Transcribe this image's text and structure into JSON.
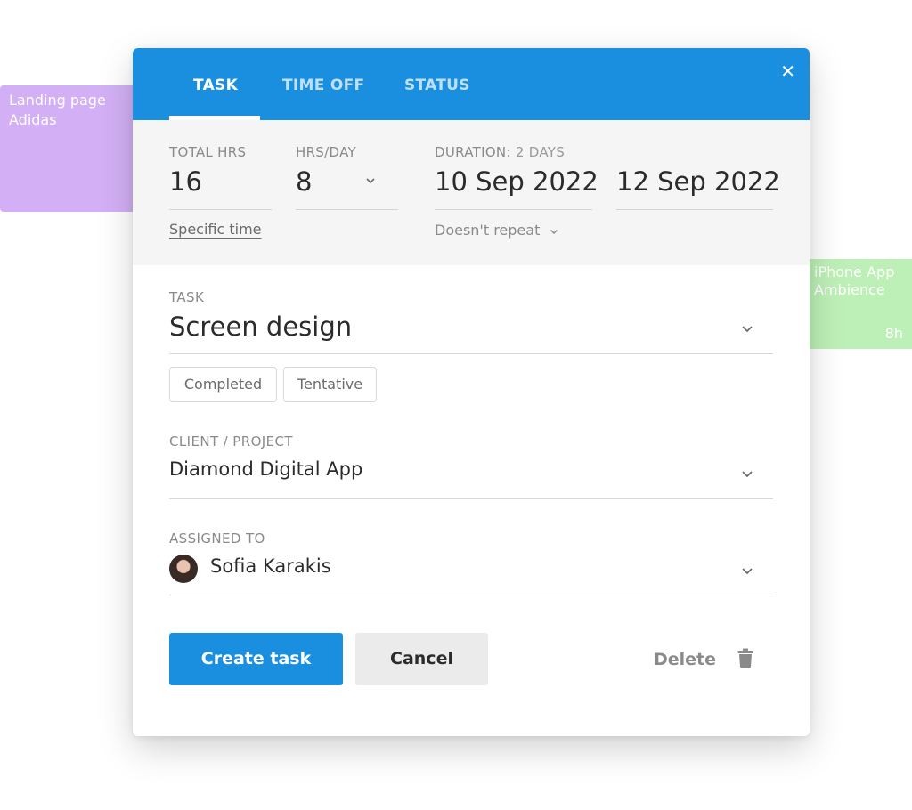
{
  "background_cards": {
    "left": {
      "title": "Landing page Adidas",
      "color": "#d3b0f5"
    },
    "right": {
      "title": "iPhone App Ambience",
      "hours": "8h",
      "color": "#bdf0b6"
    }
  },
  "tabs": [
    {
      "label": "TASK",
      "active": true
    },
    {
      "label": "TIME OFF",
      "active": false
    },
    {
      "label": "STATUS",
      "active": false
    }
  ],
  "summary": {
    "total_hrs_label": "TOTAL HRS",
    "total_hrs_value": "16",
    "specific_time_link": "Specific time",
    "hrs_per_day_label": "HRS/DAY",
    "hrs_per_day_value": "8",
    "duration_label": "DURATION:",
    "duration_days": "2 DAYS",
    "start_date": "10 Sep 2022",
    "end_date": "12 Sep 2022",
    "repeat": "Doesn't repeat"
  },
  "task": {
    "label": "TASK",
    "value": "Screen design",
    "chips": [
      "Completed",
      "Tentative"
    ]
  },
  "client": {
    "label": "CLIENT / PROJECT",
    "value": "Diamond Digital App"
  },
  "assigned": {
    "label": "ASSIGNED TO",
    "value": "Sofia Karakis"
  },
  "actions": {
    "create": "Create task",
    "cancel": "Cancel",
    "delete": "Delete"
  },
  "colors": {
    "primary": "#1a8fe0",
    "summary_bg": "#f5f5f5",
    "cancel_bg": "#ebebeb"
  }
}
